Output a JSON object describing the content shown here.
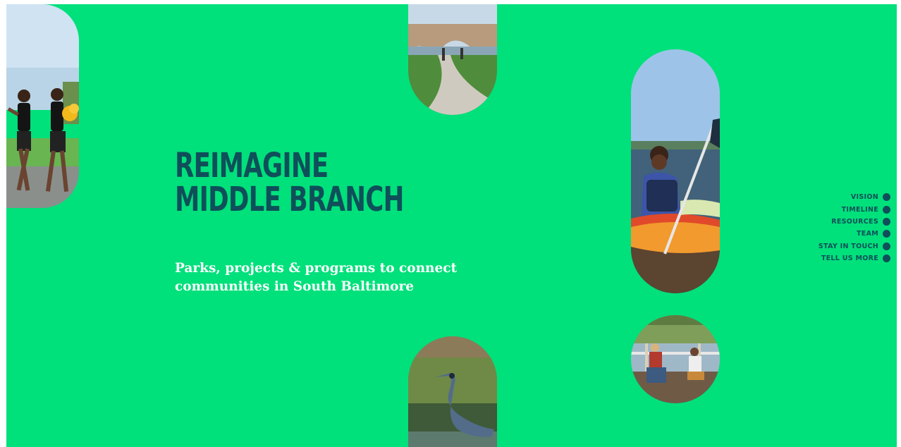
{
  "hero": {
    "title_line1": "REIMAGINE",
    "title_line2": "MIDDLE BRANCH",
    "subtitle_line1": "Parks, projects & programs to connect",
    "subtitle_line2": "communities in South Baltimore"
  },
  "nav": {
    "items": [
      {
        "label": "VISION"
      },
      {
        "label": "TIMELINE"
      },
      {
        "label": "RESOURCES"
      },
      {
        "label": "TEAM"
      },
      {
        "label": "STAY IN TOUCH"
      },
      {
        "label": "TELL US MORE"
      }
    ]
  },
  "colors": {
    "background": "#00e07b",
    "title": "#0f4f5a",
    "subtitle": "#ffffff",
    "nav": "#0f4f5a"
  }
}
